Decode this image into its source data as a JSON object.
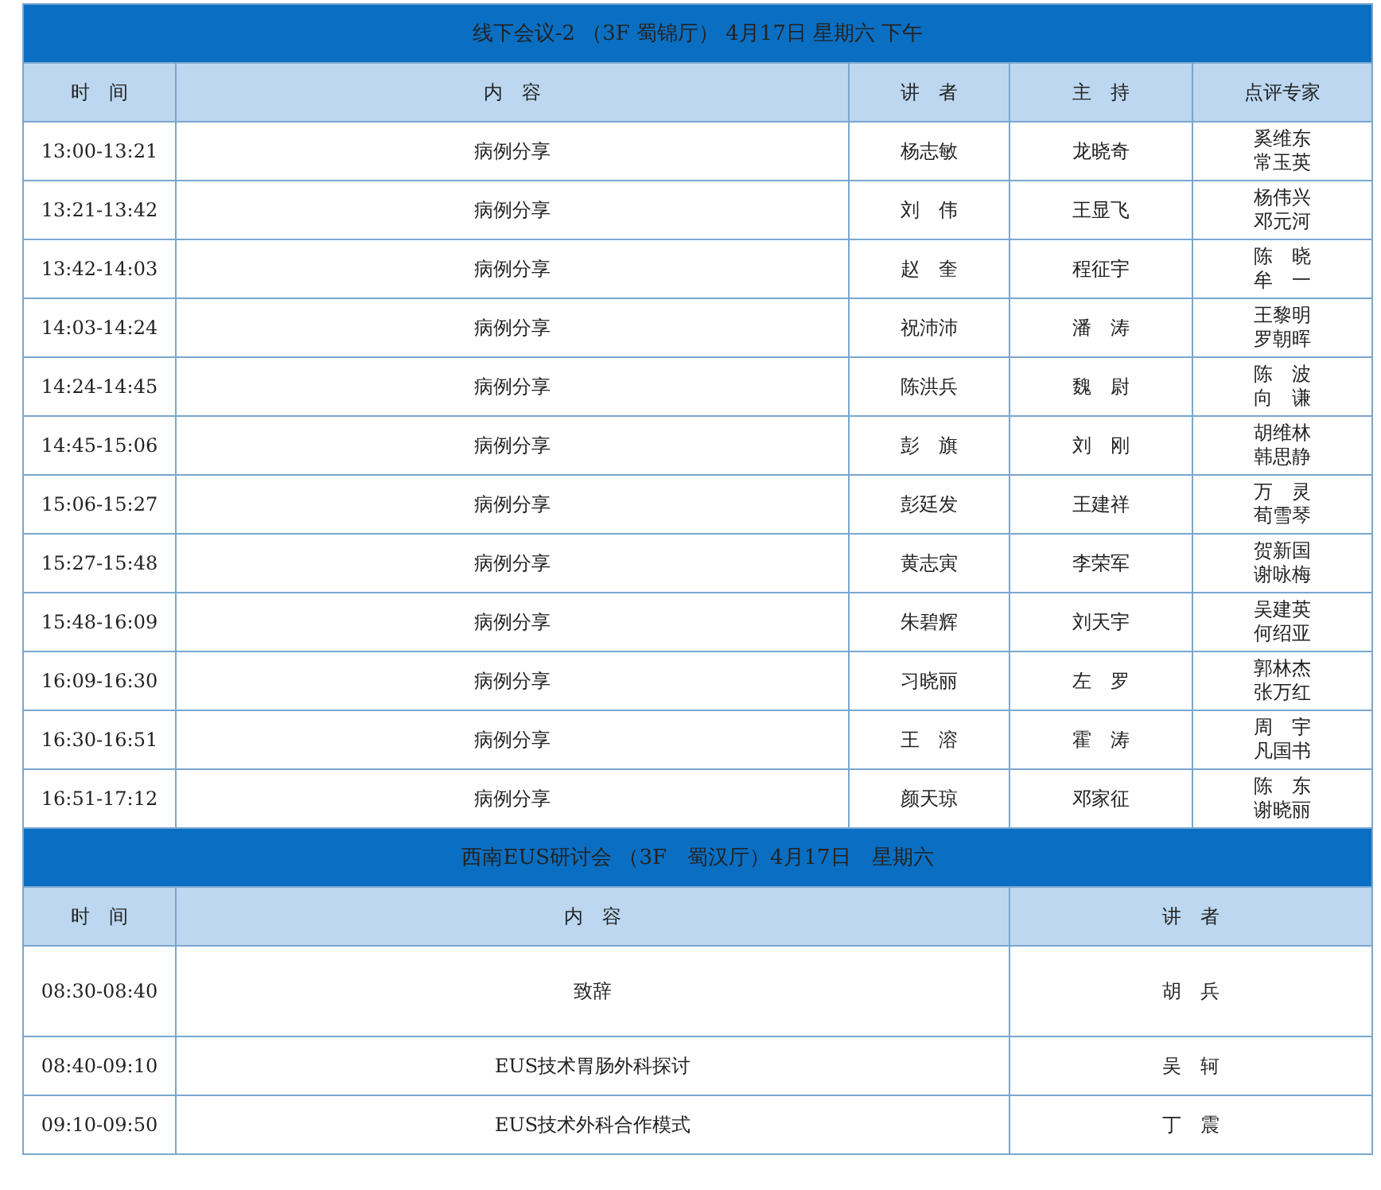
{
  "sections": [
    {
      "title": "线下会议-2 （3F 蜀锦厅）  4月17日  星期六 下午",
      "columns": [
        "时　间",
        "内　容",
        "讲　者",
        "主　持",
        "点评专家"
      ],
      "rows": [
        {
          "time": "13:00-13:21",
          "content": "病例分享",
          "speaker": "杨志敏",
          "host": "龙晓奇",
          "experts": [
            "奚维东",
            "常玉英"
          ]
        },
        {
          "time": "13:21-13:42",
          "content": "病例分享",
          "speaker": "刘　伟",
          "host": "王显飞",
          "experts": [
            "杨伟兴",
            "邓元河"
          ]
        },
        {
          "time": "13:42-14:03",
          "content": "病例分享",
          "speaker": "赵　奎",
          "host": "程征宇",
          "experts": [
            "陈　晓",
            "牟　一"
          ]
        },
        {
          "time": "14:03-14:24",
          "content": "病例分享",
          "speaker": "祝沛沛",
          "host": "潘　涛",
          "experts": [
            "王黎明",
            "罗朝晖"
          ]
        },
        {
          "time": "14:24-14:45",
          "content": "病例分享",
          "speaker": "陈洪兵",
          "host": "魏　尉",
          "experts": [
            "陈　波",
            "向　谦"
          ]
        },
        {
          "time": "14:45-15:06",
          "content": "病例分享",
          "speaker": "彭　旗",
          "host": "刘　刚",
          "experts": [
            "胡维林",
            "韩思静"
          ]
        },
        {
          "time": "15:06-15:27",
          "content": "病例分享",
          "speaker": "彭廷发",
          "host": "王建祥",
          "experts": [
            "万　灵",
            "荀雪琴"
          ]
        },
        {
          "time": "15:27-15:48",
          "content": "病例分享",
          "speaker": "黄志寅",
          "host": "李荣军",
          "experts": [
            "贺新国",
            "谢咏梅"
          ]
        },
        {
          "time": "15:48-16:09",
          "content": "病例分享",
          "speaker": "朱碧辉",
          "host": "刘天宇",
          "experts": [
            "吴建英",
            "何绍亚"
          ]
        },
        {
          "time": "16:09-16:30",
          "content": "病例分享",
          "speaker": "习晓丽",
          "host": "左　罗",
          "experts": [
            "郭林杰",
            "张万红"
          ]
        },
        {
          "time": "16:30-16:51",
          "content": "病例分享",
          "speaker": "王　溶",
          "host": "霍　涛",
          "experts": [
            "周　宇",
            "凡国书"
          ]
        },
        {
          "time": "16:51-17:12",
          "content": "病例分享",
          "speaker": "颜天琼",
          "host": "邓家征",
          "experts": [
            "陈　东",
            "谢晓丽"
          ]
        }
      ]
    },
    {
      "title": "西南EUS研讨会 （3F　蜀汉厅）4月17日　星期六",
      "columns": [
        "时　间",
        "内　容",
        "讲　者"
      ],
      "rows": [
        {
          "time": "08:30-08:40",
          "content": "致辞",
          "speaker": "胡　兵",
          "tall": true
        },
        {
          "time": "08:40-09:10",
          "content": "EUS技术胃肠外科探讨",
          "speaker": "吴　轲"
        },
        {
          "time": "09:10-09:50",
          "content": "EUS技术外科合作模式",
          "speaker": "丁　震"
        }
      ]
    }
  ]
}
